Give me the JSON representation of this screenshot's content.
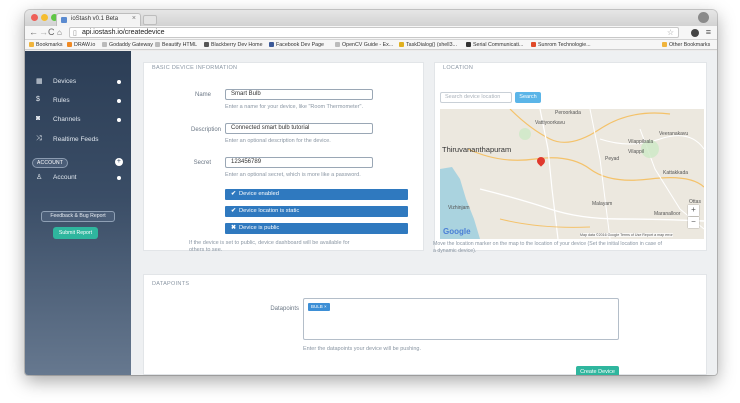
{
  "browser": {
    "tab_title": "ioStash v0.1 Beta",
    "url": "api.iostash.io/createdevice",
    "bookmarks": [
      {
        "label": "Bookmarks",
        "color": "#f0b43c"
      },
      {
        "label": "DRAW.io",
        "color": "#f08a24"
      },
      {
        "label": "Godaddy Gateway",
        "color": "#bbbbbb"
      },
      {
        "label": "Beautify HTML",
        "color": "#bbbbbb"
      },
      {
        "label": "Blackberry Dev Home",
        "color": "#555555"
      },
      {
        "label": "Facebook Dev Page",
        "color": "#3b5998"
      },
      {
        "label": "OpenCV Guide - Ex...",
        "color": "#bbbbbb"
      },
      {
        "label": "TaskDialog() (shell3...",
        "color": "#e0b020"
      },
      {
        "label": "Serial Communicati...",
        "color": "#333333"
      },
      {
        "label": "Sunrom Technologie...",
        "color": "#e04a2a"
      },
      {
        "label": "Other Bookmarks",
        "color": "#f0b43c"
      }
    ]
  },
  "sidebar": {
    "items": [
      {
        "label": "Devices",
        "icon": "grid-icon"
      },
      {
        "label": "Rules",
        "icon": "dollar-icon"
      },
      {
        "label": "Channels",
        "icon": "camera-icon"
      },
      {
        "label": "Realtime Feeds",
        "icon": "shuffle-icon"
      }
    ],
    "account_header": "ACCOUNT",
    "account_item": {
      "label": "Account",
      "icon": "user-icon"
    },
    "feedback_label": "Feedback & Bug Report",
    "submit_label": "Submit Report"
  },
  "device_info": {
    "title": "BASIC DEVICE INFORMATION",
    "name_label": "Name",
    "name_value": "Smart Bulb",
    "name_help": "Enter a name for your device, like \"Room Thermometer\".",
    "description_label": "Description",
    "description_value": "Connected smart bulb tutorial",
    "description_help": "Enter an optional description for the device.",
    "secret_label": "Secret",
    "secret_value": "123456789",
    "secret_help": "Enter an optional secret, which is more like a password.",
    "toggles": [
      {
        "label": "Device enabled",
        "mark": "✔"
      },
      {
        "label": "Device location is static",
        "mark": "✔"
      },
      {
        "label": "Device is public",
        "mark": "✖"
      }
    ],
    "public_help_1": "If the device is set to public, device dashboard will be available for",
    "public_help_2": "others to see."
  },
  "location": {
    "title": "LOCATION",
    "search_placeholder": "Search device location",
    "search_button": "Search",
    "map_labels": {
      "city": "Thiruvananthapuram",
      "peroorkada": "Peroorkada",
      "vattiyoorkavu": "Vattiyoorkavu",
      "veeranakavu": "Veeranakavu",
      "vilappilsala": "Vilappilsala",
      "vilappil": "Vilappil",
      "peyad": "Peyad",
      "kattakkada": "Kattakkada",
      "ottasekharamangalam": "Ottas",
      "malayam": "Malayam",
      "maranalloor": "Maranalloor",
      "vizhinjam": "Vizhinjam",
      "google": "Google",
      "attribution": "Map data ©2016 Google   Terms of Use   Report a map error"
    },
    "help_1": "Move the location marker on the map to the location of your device (Set the initial location in case of",
    "help_2": "a dynamic device)."
  },
  "datapoints": {
    "title": "DATAPOINTS",
    "label": "Datapoints",
    "tags": [
      "BULB"
    ],
    "help": "Enter the datapoints your device will be pushing.",
    "create_button": "Create Device"
  }
}
